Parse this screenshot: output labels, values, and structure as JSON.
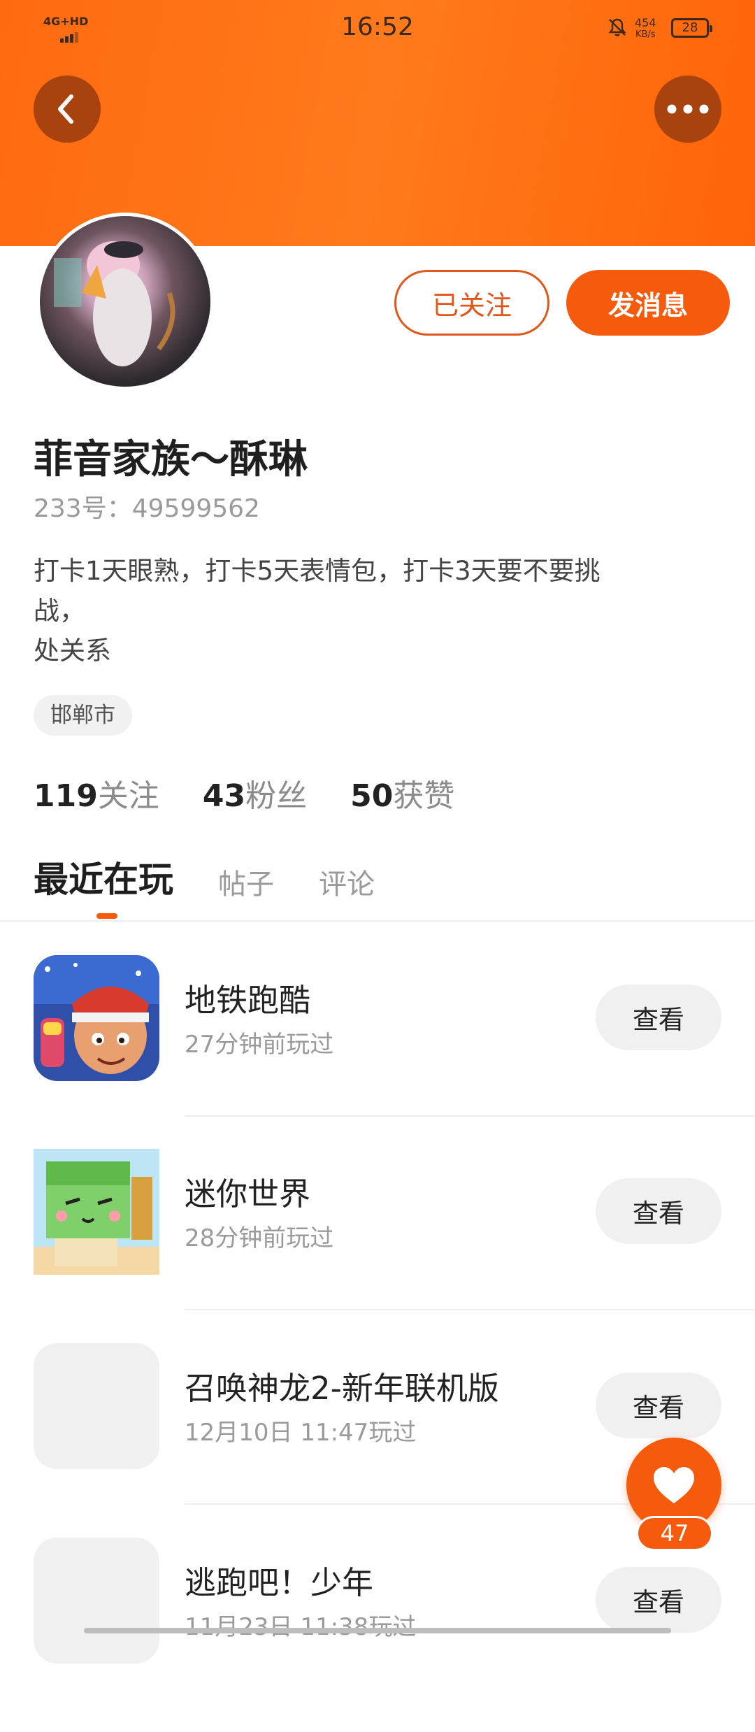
{
  "status_bar": {
    "network": "4G+HD",
    "time": "16:52",
    "net_speed_value": "454",
    "net_speed_unit": "KB/s",
    "battery": "28"
  },
  "profile": {
    "name": "菲音家族～酥琳",
    "uid": "233号：49599562",
    "bio": "打卡1天眼熟，打卡5天表情包，打卡3天要不要挑\n战，\n处关系",
    "location": "邯郸市",
    "follow_button": "已关注",
    "message_button": "发消息"
  },
  "stats": [
    {
      "value": "119",
      "label": "关注"
    },
    {
      "value": "43",
      "label": "粉丝"
    },
    {
      "value": "50",
      "label": "获赞"
    }
  ],
  "tabs": [
    {
      "label": "最近在玩",
      "active": true
    },
    {
      "label": "帖子",
      "active": false
    },
    {
      "label": "评论",
      "active": false
    }
  ],
  "games": [
    {
      "title": "地铁跑酷",
      "subtitle": "27分钟前玩过",
      "button": "查看",
      "icon": "subway-surfers-icon"
    },
    {
      "title": "迷你世界",
      "subtitle": "28分钟前玩过",
      "button": "查看",
      "icon": "mini-world-icon"
    },
    {
      "title": "召唤神龙2-新年联机版",
      "subtitle": "12月10日 11:47玩过",
      "button": "查看",
      "icon": "placeholder-icon"
    },
    {
      "title": "逃跑吧！少年",
      "subtitle": "11月23日 11:38玩过",
      "button": "查看",
      "icon": "placeholder-icon"
    }
  ],
  "fab": {
    "count": "47",
    "icon": "heart-icon"
  },
  "colors": {
    "accent": "#f55a0d",
    "header": "#ff6a10"
  }
}
